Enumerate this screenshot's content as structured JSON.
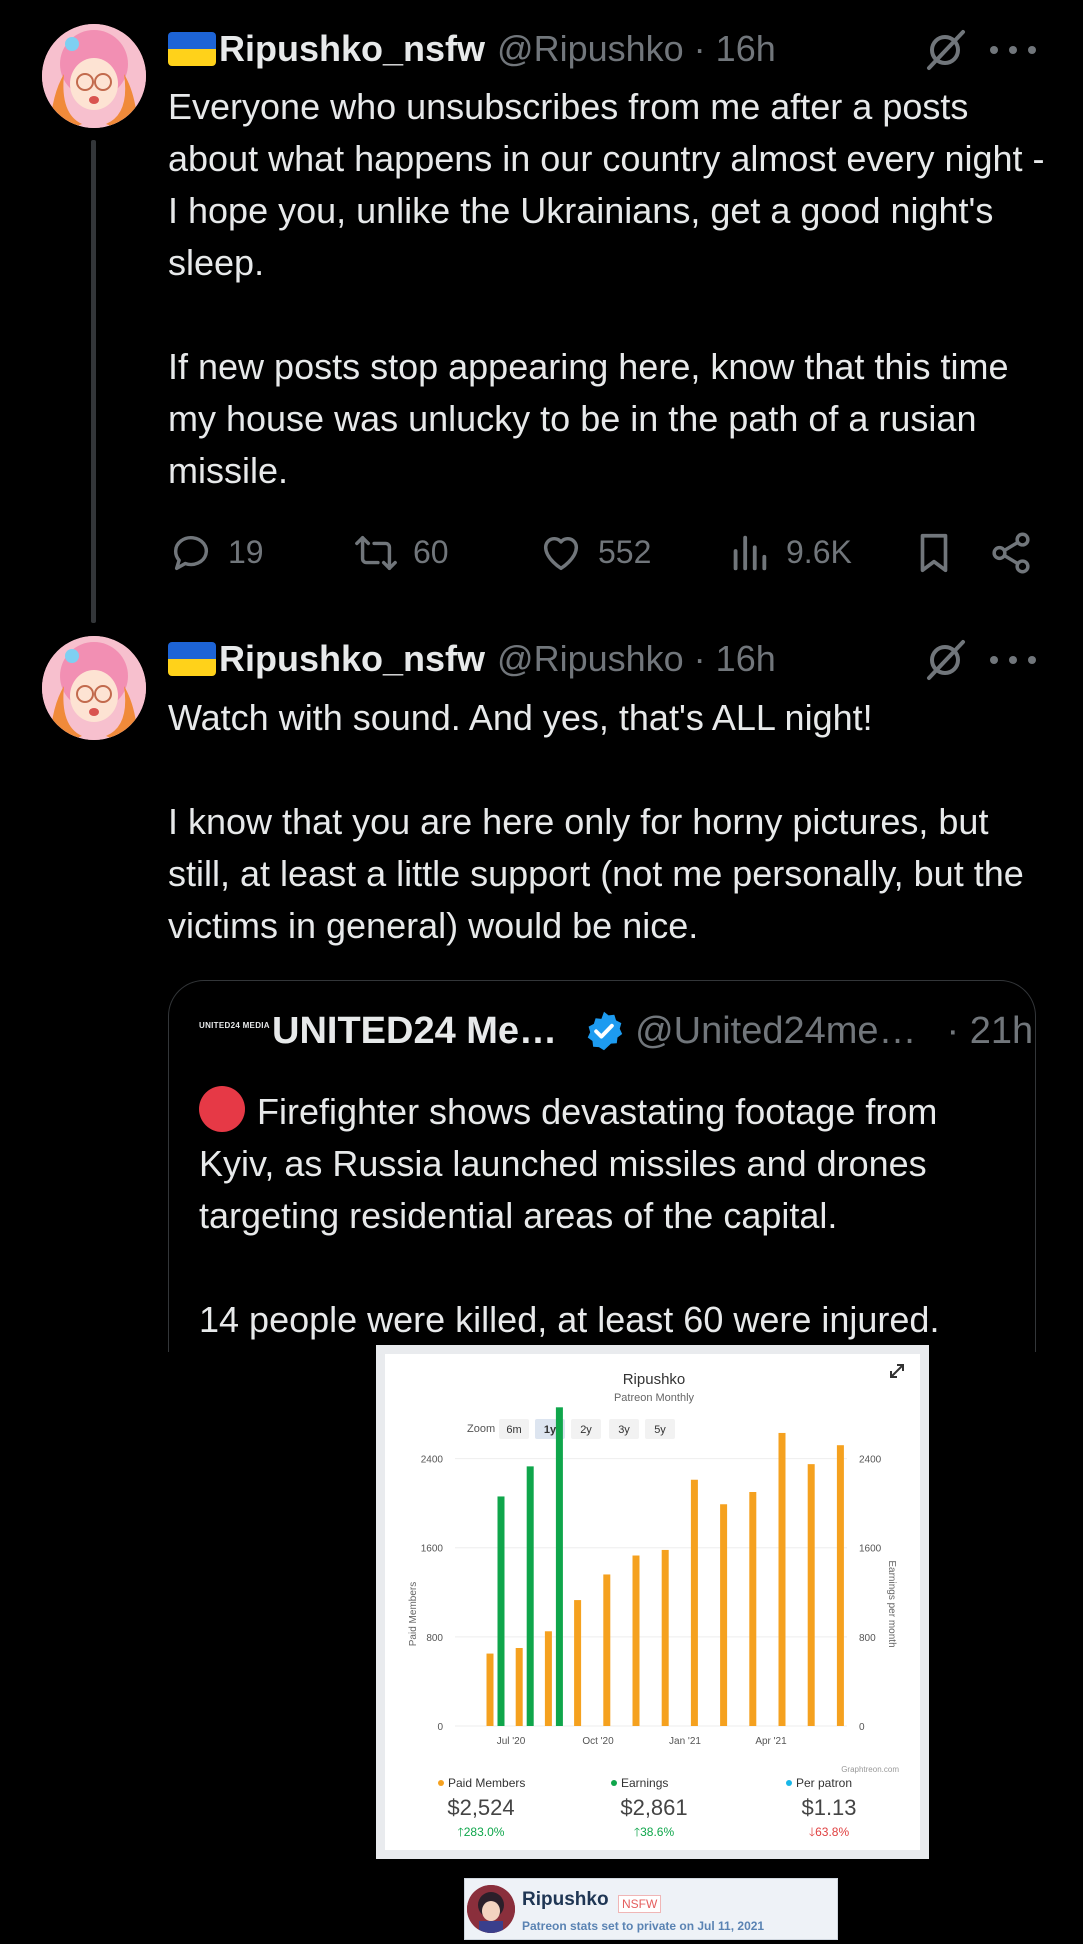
{
  "tweets": [
    {
      "display_name": "Ripushko_nsfw",
      "handle": "@Ripushko",
      "separator": "·",
      "time": "16h",
      "paragraphs": [
        "Everyone who unsubscribes from me after a posts about what happens in our country almost every night - I hope you, unlike the Ukrainians, get a good night's sleep.",
        "If new posts stop appearing here, know that this time my house was unlucky to be in the path of a rusian missile."
      ],
      "stats": {
        "replies": "19",
        "reposts": "60",
        "likes": "552",
        "views": "9.6K"
      }
    },
    {
      "display_name": "Ripushko_nsfw",
      "handle": "@Ripushko",
      "separator": "·",
      "time": "16h",
      "paragraphs": [
        "Watch with sound. And yes, that's ALL night!",
        "I know that you are here only for horny pictures, but still, at least a little support (not me personally, but the victims in general) would be nice."
      ]
    }
  ],
  "quote": {
    "logo_text": "UNITED24 MEDIA",
    "display_name": "UNITED24 Me…",
    "handle": "@United24me…",
    "time": "· 21h",
    "paragraphs": [
      "Firefighter shows devastating footage from Kyiv, as Russia launched missiles and drones targeting residential areas of the capital.",
      "14 people were killed, at least 60 were injured."
    ]
  },
  "icons": [
    "avatar",
    "ukraine-flag-icon",
    "grok-icon",
    "more-icon",
    "reply-icon",
    "repost-icon",
    "like-icon",
    "views-icon",
    "bookmark-icon",
    "share-icon",
    "verified-icon",
    "red-circle-icon",
    "expand-icon"
  ],
  "colors": {
    "background": "#000000",
    "text": "#e7e9ea",
    "muted": "#71767b",
    "verified": "#1d9bf0",
    "orange": "#f5a11f",
    "green": "#0fa64b",
    "cyan": "#19b7e8"
  },
  "chart_data": {
    "type": "bar",
    "title": "Ripushko",
    "subtitle": "Patreon Monthly",
    "zoom_label": "Zoom",
    "zoom_options": [
      "6m",
      "1y",
      "2y",
      "3y",
      "5y"
    ],
    "zoom_selected": "1y",
    "ylabel_left": "Paid Members",
    "ylabel_right": "Earnings per month",
    "yticks": [
      "0",
      "800",
      "1600",
      "2400"
    ],
    "ylim": [
      0,
      2800
    ],
    "xticks": [
      "Jul '20",
      "Oct '20",
      "Jan '21",
      "Apr '21"
    ],
    "credit": "Graphtreon.com",
    "series": [
      {
        "name": "Paid Members",
        "color": "#f5a11f",
        "values": [
          650,
          700,
          850,
          1130,
          1360,
          1530,
          1580,
          2210,
          1990,
          2100,
          2630,
          2350,
          2520
        ]
      },
      {
        "name": "Earnings",
        "color": "#0fa64b",
        "values": [
          2060,
          2330,
          2860,
          null,
          null,
          null,
          null,
          null,
          null,
          null,
          null,
          null,
          null
        ]
      }
    ],
    "summary": [
      {
        "label": "Paid Members",
        "color": "#f5a11f",
        "value": "$2,524",
        "change": "283.0%",
        "direction": "up"
      },
      {
        "label": "Earnings",
        "color": "#0fa64b",
        "value": "$2,861",
        "change": "38.6%",
        "direction": "up"
      },
      {
        "label": "Per patron",
        "color": "#19b7e8",
        "value": "$1.13",
        "change": "63.8%",
        "direction": "down"
      }
    ]
  },
  "profile_strip": {
    "name": "Ripushko",
    "badge": "NSFW",
    "note": "Patreon stats set to private on Jul 11, 2021"
  }
}
